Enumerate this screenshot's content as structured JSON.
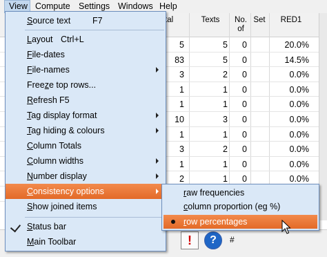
{
  "menubar": {
    "items": [
      "View",
      "Compute",
      "Settings",
      "Windows",
      "Help"
    ]
  },
  "grid": {
    "headers": [
      "tal",
      "Texts",
      "No.\nof",
      "Set",
      "RED1"
    ],
    "rows": [
      [
        "5",
        "5",
        "0",
        "20.0%"
      ],
      [
        "83",
        "5",
        "0",
        "14.5%"
      ],
      [
        "3",
        "2",
        "0",
        "0.0%"
      ],
      [
        "1",
        "1",
        "0",
        "0.0%"
      ],
      [
        "1",
        "1",
        "0",
        "0.0%"
      ],
      [
        "10",
        "3",
        "0",
        "0.0%"
      ],
      [
        "1",
        "1",
        "0",
        "0.0%"
      ],
      [
        "3",
        "2",
        "0",
        "0.0%"
      ],
      [
        "1",
        "1",
        "0",
        "0.0%"
      ],
      [
        "2",
        "1",
        "0",
        "0.0%"
      ],
      [
        "1",
        "1",
        "0",
        "0.0%"
      ]
    ]
  },
  "toolbar": {
    "hash": "#",
    "warning": "!",
    "help": "?"
  },
  "view_menu": {
    "items": [
      {
        "label": "Source text",
        "underline": "S",
        "shortcut": "F7"
      },
      {
        "label": "Layout",
        "underline": "L",
        "shortcut": "Ctrl+L"
      },
      {
        "label": "File-dates",
        "underline": "F"
      },
      {
        "label": "File-names",
        "underline": "F",
        "submenu": true
      },
      {
        "label": "Freeze top rows...",
        "underline": "z"
      },
      {
        "label": "Refresh",
        "underline": "R",
        "shortcut": "F5"
      },
      {
        "label": "Tag display format",
        "underline": "T",
        "submenu": true
      },
      {
        "label": "Tag hiding & colours",
        "underline": "T",
        "submenu": true
      },
      {
        "label": "Column Totals",
        "underline": "C"
      },
      {
        "label": "Column widths",
        "underline": "C",
        "submenu": true
      },
      {
        "label": "Number display",
        "underline": "N",
        "submenu": true
      },
      {
        "label": "Consistency options",
        "underline": "C",
        "submenu": true,
        "selected": true
      },
      {
        "label": "Show joined items",
        "underline": "S"
      },
      {
        "label": "Status bar",
        "underline": "S",
        "checked": true
      },
      {
        "label": "Main Toolbar",
        "underline": "M"
      }
    ]
  },
  "consistency_submenu": {
    "items": [
      {
        "label": "raw frequencies",
        "underline": "r"
      },
      {
        "label": "column proportion (eg %)",
        "underline": "c"
      },
      {
        "label": "row percentages",
        "underline": "r",
        "selected": true,
        "radio": true
      }
    ]
  },
  "colors": {
    "highlight": "#e8742f",
    "menu_bg": "#dae8f7",
    "menubar_active": "#c2d8ef"
  }
}
